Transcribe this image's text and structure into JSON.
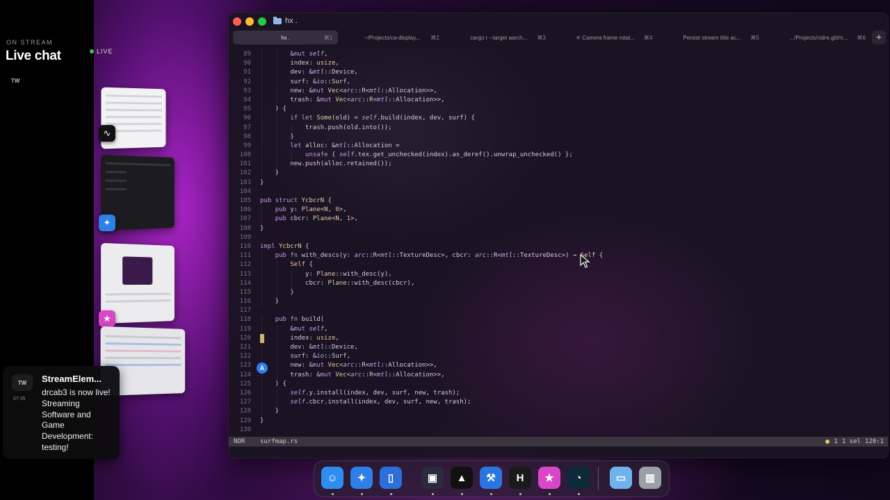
{
  "chat": {
    "eyebrow": "ON STREAM",
    "title": "Live chat",
    "platform": "TW",
    "live_label": "LIVE"
  },
  "notification": {
    "avatar": "TW",
    "time": "07:35",
    "title": "StreamElem...",
    "body": "drcab3 is now live! Streaming Software and Game Development: testing!"
  },
  "window": {
    "title": "hx .",
    "tabs": [
      {
        "label": "hx .",
        "shortcut": "⌘1",
        "active": true
      },
      {
        "label": "~/Projects/ca-display...",
        "shortcut": "⌘2",
        "active": false
      },
      {
        "label": "cargo r --target aarch...",
        "shortcut": "⌘3",
        "active": false
      },
      {
        "label": "✳ Camera frame rotat...",
        "shortcut": "⌘4",
        "active": false
      },
      {
        "label": "Persist stream title ac...",
        "shortcut": "⌘5",
        "active": false
      },
      {
        "label": ".../Projects/cidre.git/m...",
        "shortcut": "⌘6",
        "active": false
      }
    ],
    "new_tab": "+"
  },
  "editor": {
    "lines": [
      {
        "n": "89",
        "t": "        &mut self,"
      },
      {
        "n": "90",
        "t": "        index: usize,"
      },
      {
        "n": "91",
        "t": "        dev: &mtl::Device,"
      },
      {
        "n": "92",
        "t": "        surf: &io::Surf,"
      },
      {
        "n": "93",
        "t": "        new: &mut Vec<arc::R<mtl::Allocation>>,"
      },
      {
        "n": "94",
        "t": "        trash: &mut Vec<arc::R<mtl::Allocation>>,"
      },
      {
        "n": "95",
        "t": "    ) {"
      },
      {
        "n": "96",
        "t": "        if let Some(old) = self.build(index, dev, surf) {"
      },
      {
        "n": "97",
        "t": "            trash.push(old.into());"
      },
      {
        "n": "98",
        "t": "        }"
      },
      {
        "n": "99",
        "t": "        let alloc: &mtl::Allocation ="
      },
      {
        "n": "100",
        "t": "            unsafe { self.tex.get_unchecked(index).as_deref().unwrap_unchecked() };"
      },
      {
        "n": "101",
        "t": "        new.push(alloc.retained());"
      },
      {
        "n": "102",
        "t": "    }"
      },
      {
        "n": "103",
        "t": "}"
      },
      {
        "n": "104",
        "t": ""
      },
      {
        "n": "105",
        "t": "pub struct YcbcrN {"
      },
      {
        "n": "106",
        "t": "    pub y: Plane<N, 0>,"
      },
      {
        "n": "107",
        "t": "    pub cbcr: Plane<N, 1>,"
      },
      {
        "n": "108",
        "t": "}"
      },
      {
        "n": "109",
        "t": ""
      },
      {
        "n": "110",
        "t": "impl YcbcrN {"
      },
      {
        "n": "111",
        "t": "    pub fn with_descs(y: arc::R<mtl::TextureDesc>, cbcr: arc::R<mtl::TextureDesc>) → Self {"
      },
      {
        "n": "112",
        "t": "        Self {"
      },
      {
        "n": "113",
        "t": "            y: Plane::with_desc(y),"
      },
      {
        "n": "114",
        "t": "            cbcr: Plane::with_desc(cbcr),"
      },
      {
        "n": "115",
        "t": "        }"
      },
      {
        "n": "116",
        "t": "    }"
      },
      {
        "n": "117",
        "t": ""
      },
      {
        "n": "118",
        "t": "    pub fn build("
      },
      {
        "n": "119",
        "t": "        &mut self,"
      },
      {
        "n": "120",
        "t": "        index: usize,"
      },
      {
        "n": "121",
        "t": "        dev: &mtl::Device,"
      },
      {
        "n": "122",
        "t": "        surf: &io::Surf,"
      },
      {
        "n": "123",
        "t": "        new: &mut Vec<arc::R<mtl::Allocation>>,"
      },
      {
        "n": "124",
        "t": "        trash: &mut Vec<arc::R<mtl::Allocation>>,"
      },
      {
        "n": "125",
        "t": "    ) {"
      },
      {
        "n": "126",
        "t": "        self.y.install(index, dev, surf, new, trash);"
      },
      {
        "n": "127",
        "t": "        self.cbcr.install(index, dev, surf, new, trash);"
      },
      {
        "n": "128",
        "t": "    }"
      },
      {
        "n": "129",
        "t": "}"
      },
      {
        "n": "130",
        "t": ""
      }
    ],
    "gutter_marker": "A"
  },
  "status": {
    "mode": "NOR",
    "file": "surfmap.rs",
    "diagnostics": "1",
    "selections": "1 sel",
    "position": "120:1"
  },
  "dock": {
    "apps": [
      {
        "name": "finder-icon",
        "bg": "#2f8df0",
        "glyph": "☺"
      },
      {
        "name": "safari-icon",
        "bg": "#2f7fe8",
        "glyph": "✦"
      },
      {
        "name": "simulator-icon",
        "bg": "#2c6fd8",
        "glyph": "▯"
      },
      {
        "name": "terminal-icon",
        "bg": "#2a2a40",
        "glyph": "▣"
      },
      {
        "name": "activity-monitor-icon",
        "bg": "#111",
        "glyph": "▲"
      },
      {
        "name": "xcode-icon",
        "bg": "#2a76e0",
        "glyph": "⚒"
      },
      {
        "name": "helix-icon",
        "bg": "#1a1a1a",
        "glyph": "H"
      },
      {
        "name": "star-app-icon",
        "bg": "#d946c7",
        "glyph": "★"
      },
      {
        "name": "instruments-icon",
        "bg": "#0e2a3a",
        "glyph": "◔"
      },
      {
        "name": "downloads-folder-icon",
        "bg": "#6fb3ee",
        "glyph": "▭"
      },
      {
        "name": "trash-icon",
        "bg": "#9aa0a8",
        "glyph": "▥"
      }
    ]
  }
}
